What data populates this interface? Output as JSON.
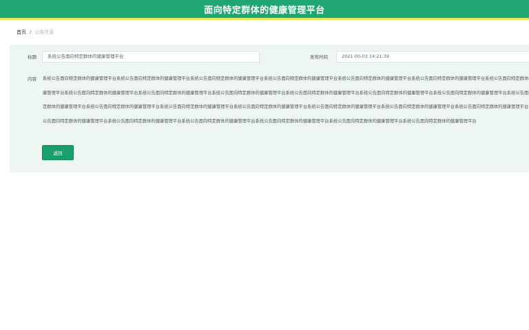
{
  "header": {
    "title": "面向特定群体的健康管理平台"
  },
  "breadcrumb": {
    "home": "首页",
    "separator": "/",
    "current": "公告信息"
  },
  "form": {
    "title_label": "标题",
    "title_value": "系统公告面向特定群体的健康管理平台",
    "time_label": "发布时间",
    "time_value": "2021-00-03 14:21:39",
    "content_label": "内容",
    "content_text": "系统公告面向特定群体的健康管理平台系统公告面向特定群体的健康管理平台系统公告面向特定群体的健康管理平台系统公告面向特定群体的健康管理平台系统公告面向特定群体的健康管理平台系统公告面向特定群体的健康管理平台系统公告面向特定群体的健康管理平台系统公告面向特定群体的健康管理平台系统公告面向特定群体的健康管理平台系统公告面向特定群体的健康管理平台系统公告面向特定群体的健康管理平台系统公告面向特定群体的健康管理平台系统公告面向特定群体的健康管理平台系统公告面向特定群体的健康管理平台系统公告面向特定群体的健康管理平台系统公告面向特定群体的健康管理平台系统公告面向特定群体的健康管理平台系统公告面向特定群体的健康管理平台系统公告面向特定群体的健康管理平台系统公告面向特定群体的健康管理平台系统公告面向特定群体的健康管理平台系统公告面向特定群体的健康管理平台系统公告面向特定群体的健康管理平台系统公告面向特定群体的健康管理平台系统公告面向特定群体的健康管理平台系统公告面向特定群体的健康管理平台",
    "back_button": "返回"
  },
  "colors": {
    "header_bg": "#1fa672",
    "accent_line": "#e4ee58",
    "panel_bg": "#edf6f1",
    "button_bg": "#1a9f6b"
  }
}
